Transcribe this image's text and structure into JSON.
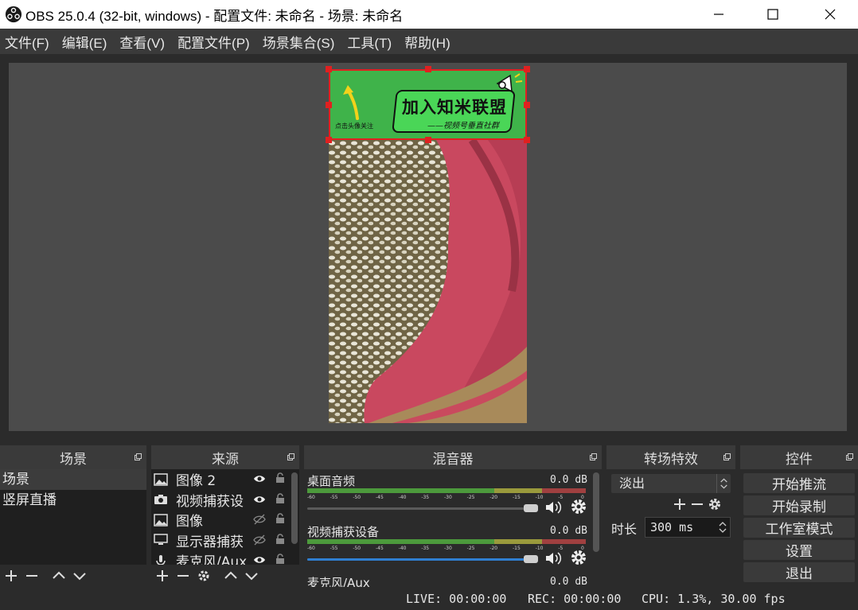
{
  "window": {
    "title": "OBS 25.0.4 (32-bit, windows) - 配置文件: 未命名 - 场景: 未命名"
  },
  "menu": [
    "文件(F)",
    "编辑(E)",
    "查看(V)",
    "配置文件(P)",
    "场景集合(S)",
    "工具(T)",
    "帮助(H)"
  ],
  "preview": {
    "banner_text": "加入知米联盟",
    "banner_subtext": "——视频号垂直社群",
    "banner_hint": "点击头像关注"
  },
  "scenes": {
    "title": "场景",
    "items": [
      "场景",
      "竖屏直播"
    ]
  },
  "sources": {
    "title": "来源",
    "items": [
      {
        "name": "图像 2",
        "icon": "image-icon",
        "visible": true
      },
      {
        "name": "视频捕获设",
        "icon": "camera-icon",
        "visible": true
      },
      {
        "name": "图像",
        "icon": "image-icon",
        "visible": false
      },
      {
        "name": "显示器捕获",
        "icon": "monitor-icon",
        "visible": false
      },
      {
        "name": "麦克风/Aux",
        "icon": "mic-icon",
        "visible": true
      }
    ]
  },
  "mixer": {
    "title": "混音器",
    "tracks": [
      {
        "name": "桌面音频",
        "db": "0.0 dB",
        "level": 0.95
      },
      {
        "name": "视频捕获设备",
        "db": "0.0 dB",
        "level": 0.95
      },
      {
        "name": "麦克风/Aux",
        "db": "0.0 dB",
        "level": 0.95
      }
    ],
    "ticks": [
      "-60",
      "-55",
      "-50",
      "-45",
      "-40",
      "-35",
      "-30",
      "-25",
      "-20",
      "-15",
      "-10",
      "-5",
      "0"
    ]
  },
  "transitions": {
    "title": "转场特效",
    "selected": "淡出",
    "duration_label": "时长",
    "duration_value": "300 ms"
  },
  "controls": {
    "title": "控件",
    "buttons": [
      "开始推流",
      "开始录制",
      "工作室模式",
      "设置",
      "退出"
    ]
  },
  "status": {
    "live": "LIVE: 00:00:00",
    "rec": "REC: 00:00:00",
    "cpu": "CPU: 1.3%, 30.00 fps"
  },
  "colors": {
    "accent": "#2f7fd1",
    "selection": "#e02020",
    "banner_green": "#3fb34a"
  }
}
